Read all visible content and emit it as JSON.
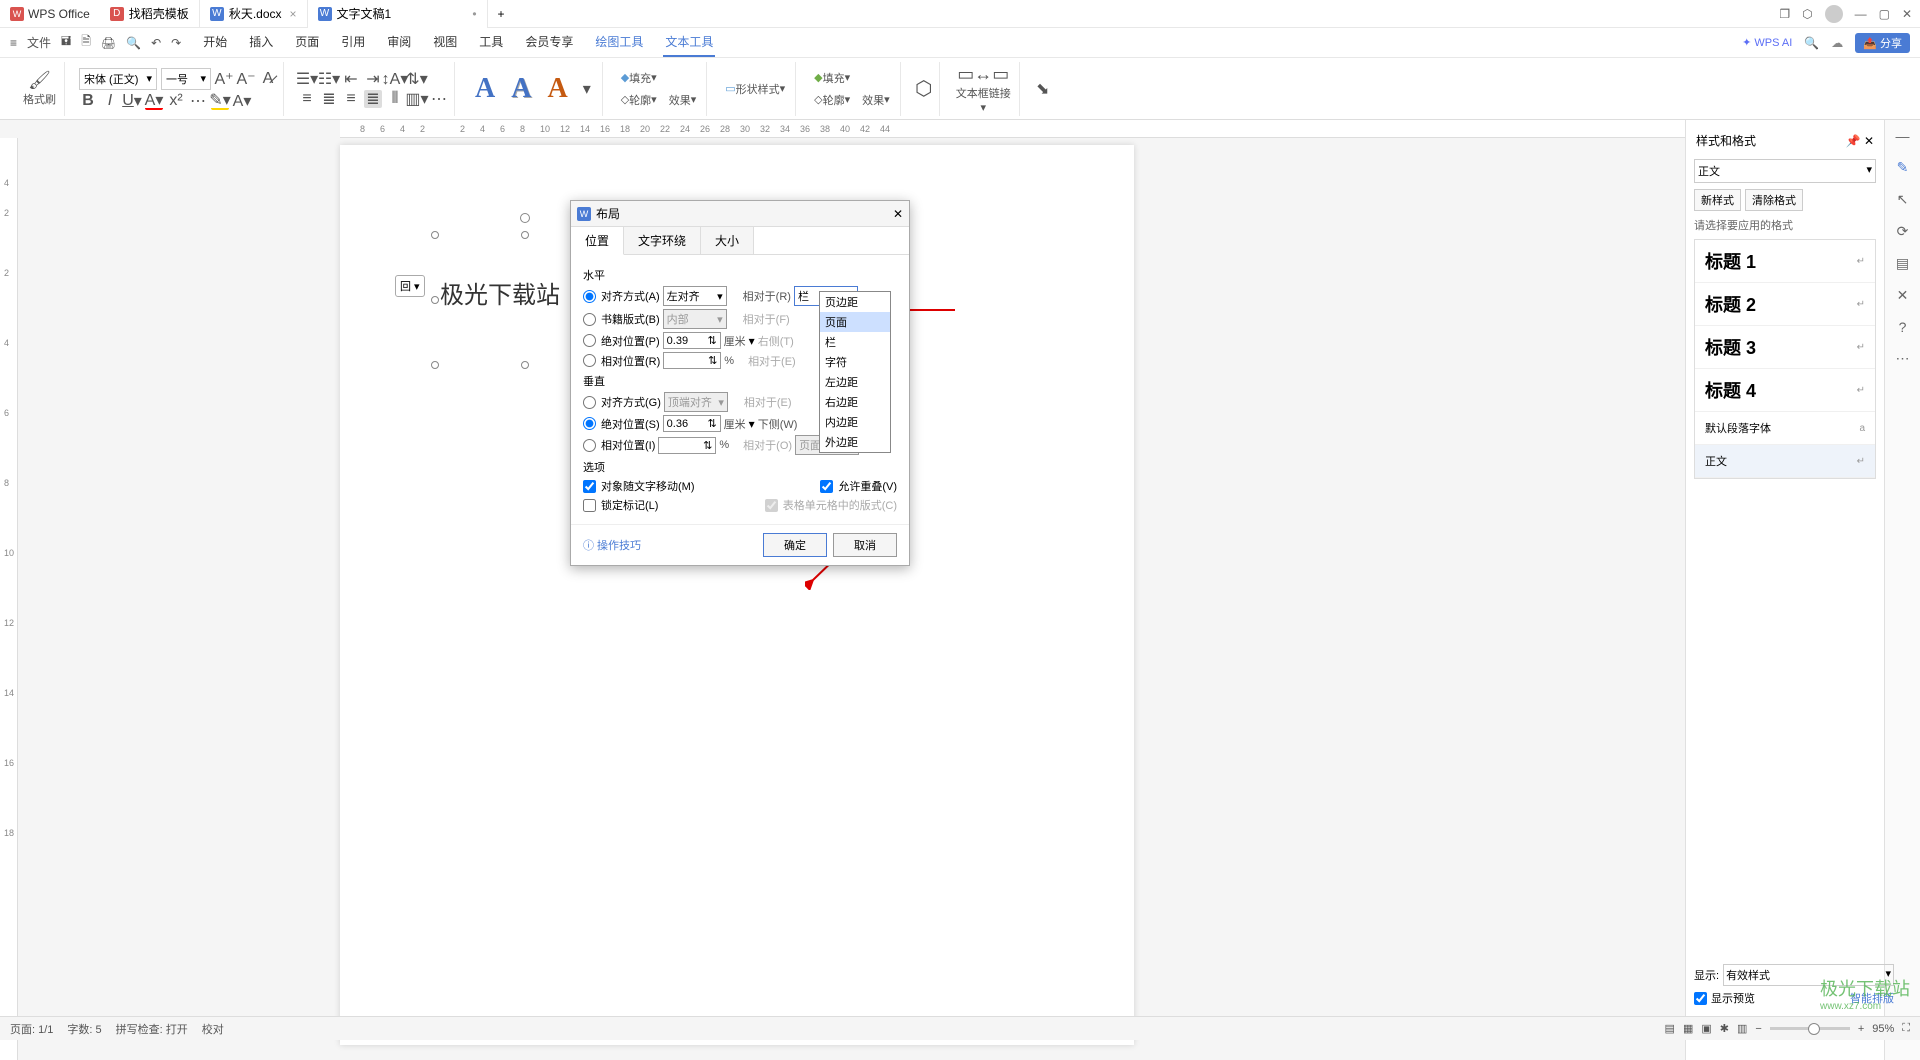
{
  "title_bar": {
    "logo": "WPS Office",
    "tabs": [
      {
        "icon_bg": "#d9534f",
        "icon_text": "D",
        "label": "找稻壳模板"
      },
      {
        "icon_bg": "#4a7bd4",
        "icon_text": "W",
        "label": "秋天.docx"
      },
      {
        "icon_bg": "#4a7bd4",
        "icon_text": "W",
        "label": "文字文稿1"
      }
    ],
    "new_tab": "+"
  },
  "menu": {
    "file": "文件",
    "tabs": [
      "开始",
      "插入",
      "页面",
      "引用",
      "审阅",
      "视图",
      "工具",
      "会员专享"
    ],
    "extra_tabs": [
      "绘图工具",
      "文本工具"
    ],
    "ai": "WPS AI",
    "share": "分享"
  },
  "ribbon": {
    "brush": "格式刷",
    "font": "宋体 (正文)",
    "size": "一号",
    "fill": "填充",
    "outline": "轮廓",
    "effect": "效果",
    "shapestyle": "形状样式",
    "outline2": "轮廓",
    "effect2": "效果",
    "textlink": "文本框链接",
    "fill2": "填充"
  },
  "document": {
    "text": "极光下载站",
    "option_badge": "回"
  },
  "dialog": {
    "title": "布局",
    "tabs": {
      "pos": "位置",
      "wrap": "文字环绕",
      "size": "大小"
    },
    "h_group": "水平",
    "align": "对齐方式(A)",
    "align_val": "左对齐",
    "rel1": "相对于(R)",
    "rel1_val": "栏",
    "book": "书籍版式(B)",
    "book_val": "内部",
    "rel2": "相对于(F)",
    "abspos": "绝对位置(P)",
    "abspos_val": "0.39",
    "unit_cm": "厘米",
    "left_of": "右侧(T)",
    "relpos": "相对位置(R)",
    "pct": "%",
    "rel3": "相对于(E)",
    "v_group": "垂直",
    "valign": "对齐方式(G)",
    "valign_val": "顶端对齐",
    "vrel1": "相对于(E)",
    "vabs": "绝对位置(S)",
    "vabs_val": "0.36",
    "below": "下侧(W)",
    "vrel": "相对位置(I)",
    "vrel2": "相对于(O)",
    "vrel2_val": "页面",
    "options": "选项",
    "move_with_text": "对象随文字移动(M)",
    "lock_anchor": "锁定标记(L)",
    "allow_overlap": "允许重叠(V)",
    "table_cell": "表格单元格中的版式(C)",
    "help": "操作技巧",
    "ok": "确定",
    "cancel": "取消",
    "dropdown_items": [
      "页边距",
      "页面",
      "栏",
      "字符",
      "左边距",
      "右边距",
      "内边距",
      "外边距"
    ]
  },
  "side_panel": {
    "header": "样式和格式",
    "current": "正文",
    "new_style": "新样式",
    "clear_format": "清除格式",
    "hint": "请选择要应用的格式",
    "styles": [
      "标题 1",
      "标题 2",
      "标题 3",
      "标题 4"
    ],
    "default_font": "默认段落字体",
    "body": "正文",
    "show": "显示:",
    "show_val": "有效样式",
    "preview": "显示预览",
    "smart": "智能排版"
  },
  "status": {
    "page": "页面: 1/1",
    "words": "字数: 5",
    "spell": "拼写检查: 打开",
    "proof": "校对",
    "zoom": "95%"
  },
  "watermark": {
    "main": "极光下载站",
    "sub": "www.xz7.com"
  }
}
